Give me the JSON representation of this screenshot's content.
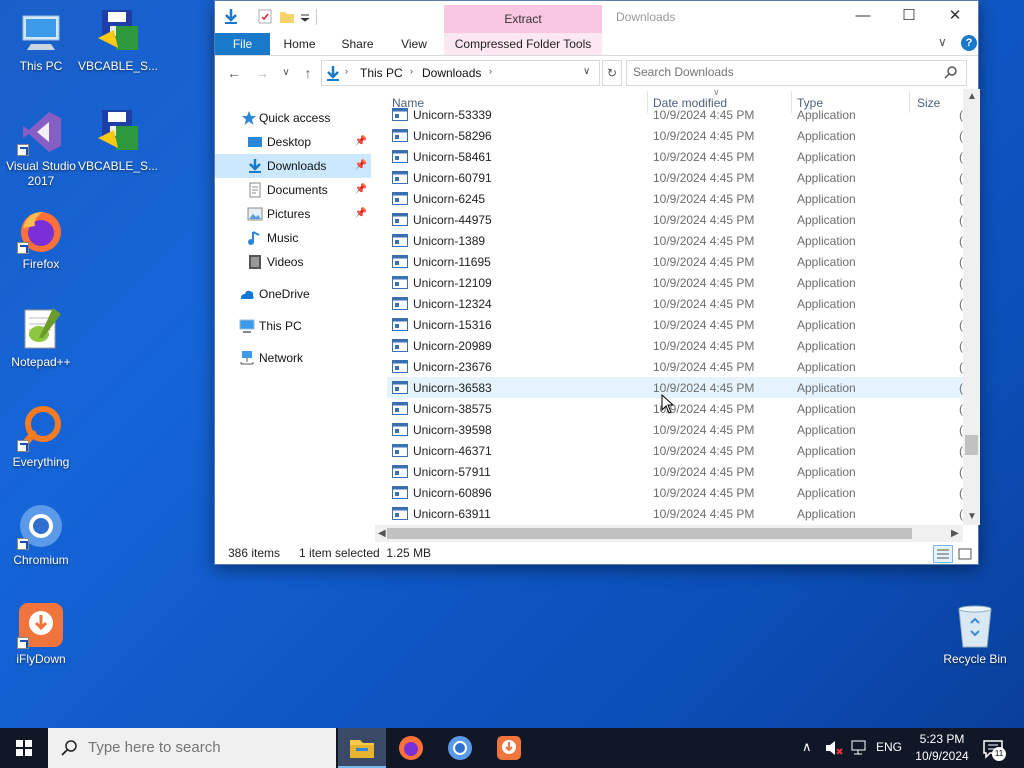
{
  "desktop": {
    "icons": [
      {
        "label": "This PC"
      },
      {
        "label": "VBCABLE_S..."
      },
      {
        "label": "Visual Studio 2017"
      },
      {
        "label": "VBCABLE_S..."
      },
      {
        "label": "Firefox"
      },
      {
        "label": "Notepad++"
      },
      {
        "label": "Everything"
      },
      {
        "label": "Chromium"
      },
      {
        "label": "iFlyDown"
      },
      {
        "label": "Recycle Bin"
      }
    ]
  },
  "explorer": {
    "title": "Downloads",
    "context_tab": "Extract",
    "tabs": [
      "File",
      "Home",
      "Share",
      "View",
      "Compressed Folder Tools"
    ],
    "address": {
      "segments": [
        "This PC",
        "Downloads"
      ]
    },
    "search": {
      "placeholder": "Search Downloads"
    },
    "nav": {
      "quick_access": "Quick access",
      "items": [
        {
          "label": "Desktop",
          "icon": "desktop-icon",
          "pinned": true
        },
        {
          "label": "Downloads",
          "icon": "downloads-icon",
          "pinned": true,
          "selected": true
        },
        {
          "label": "Documents",
          "icon": "documents-icon",
          "pinned": true
        },
        {
          "label": "Pictures",
          "icon": "pictures-icon",
          "pinned": true
        },
        {
          "label": "Music",
          "icon": "music-icon"
        },
        {
          "label": "Videos",
          "icon": "videos-icon"
        }
      ],
      "onedrive": "OneDrive",
      "this_pc": "This PC",
      "network": "Network"
    },
    "columns": {
      "name": "Name",
      "date": "Date modified",
      "type": "Type",
      "size": "Size"
    },
    "files": [
      {
        "name": "Unicorn-53339",
        "date": "10/9/2024 4:45 PM",
        "type": "Application",
        "size": "("
      },
      {
        "name": "Unicorn-58296",
        "date": "10/9/2024 4:45 PM",
        "type": "Application",
        "size": "("
      },
      {
        "name": "Unicorn-58461",
        "date": "10/9/2024 4:45 PM",
        "type": "Application",
        "size": "("
      },
      {
        "name": "Unicorn-60791",
        "date": "10/9/2024 4:45 PM",
        "type": "Application",
        "size": "("
      },
      {
        "name": "Unicorn-6245",
        "date": "10/9/2024 4:45 PM",
        "type": "Application",
        "size": "("
      },
      {
        "name": "Unicorn-44975",
        "date": "10/9/2024 4:45 PM",
        "type": "Application",
        "size": "("
      },
      {
        "name": "Unicorn-1389",
        "date": "10/9/2024 4:45 PM",
        "type": "Application",
        "size": "("
      },
      {
        "name": "Unicorn-11695",
        "date": "10/9/2024 4:45 PM",
        "type": "Application",
        "size": "("
      },
      {
        "name": "Unicorn-12109",
        "date": "10/9/2024 4:45 PM",
        "type": "Application",
        "size": "("
      },
      {
        "name": "Unicorn-12324",
        "date": "10/9/2024 4:45 PM",
        "type": "Application",
        "size": "("
      },
      {
        "name": "Unicorn-15316",
        "date": "10/9/2024 4:45 PM",
        "type": "Application",
        "size": "("
      },
      {
        "name": "Unicorn-20989",
        "date": "10/9/2024 4:45 PM",
        "type": "Application",
        "size": "("
      },
      {
        "name": "Unicorn-23676",
        "date": "10/9/2024 4:45 PM",
        "type": "Application",
        "size": "("
      },
      {
        "name": "Unicorn-36583",
        "date": "10/9/2024 4:45 PM",
        "type": "Application",
        "size": "(",
        "hover": true
      },
      {
        "name": "Unicorn-38575",
        "date": "10/9/2024 4:45 PM",
        "type": "Application",
        "size": "("
      },
      {
        "name": "Unicorn-39598",
        "date": "10/9/2024 4:45 PM",
        "type": "Application",
        "size": "("
      },
      {
        "name": "Unicorn-46371",
        "date": "10/9/2024 4:45 PM",
        "type": "Application",
        "size": "("
      },
      {
        "name": "Unicorn-57911",
        "date": "10/9/2024 4:45 PM",
        "type": "Application",
        "size": "("
      },
      {
        "name": "Unicorn-60896",
        "date": "10/9/2024 4:45 PM",
        "type": "Application",
        "size": "("
      },
      {
        "name": "Unicorn-63911",
        "date": "10/9/2024 4:45 PM",
        "type": "Application",
        "size": "("
      }
    ],
    "status": {
      "count": "386 items",
      "selection": "1 item selected  1.25 MB"
    }
  },
  "taskbar": {
    "search_placeholder": "Type here to search",
    "lang": "ENG",
    "time": "5:23 PM",
    "date": "10/9/2024",
    "notification_count": "11"
  },
  "colors": {
    "accent": "#1979ca",
    "selection": "#cce8ff",
    "hover": "#e5f3ff",
    "context_tab": "#fbc6e0"
  }
}
